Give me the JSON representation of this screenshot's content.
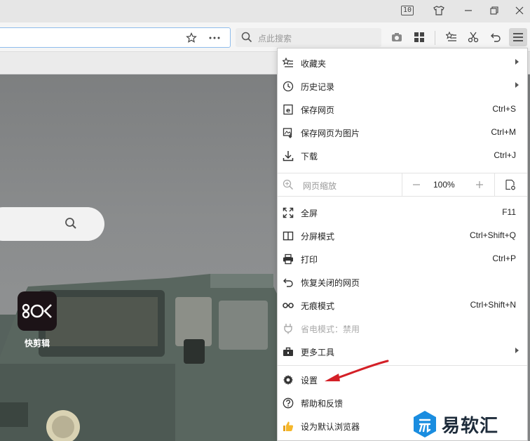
{
  "titlebar": {
    "tab_count": "10"
  },
  "toolbar": {
    "search_placeholder": "点此搜索"
  },
  "home": {
    "tile_label": "快剪辑"
  },
  "menu": {
    "items": [
      {
        "label": "收藏夹",
        "icon": "favorites-list-icon",
        "submenu": true
      },
      {
        "label": "历史记录",
        "icon": "clock-icon",
        "submenu": true
      },
      {
        "label": "保存网页",
        "icon": "save-page-icon",
        "shortcut": "Ctrl+S"
      },
      {
        "label": "保存网页为图片",
        "icon": "save-image-icon",
        "shortcut": "Ctrl+M"
      },
      {
        "label": "下载",
        "icon": "download-icon",
        "shortcut": "Ctrl+J"
      }
    ],
    "zoom": {
      "label": "网页缩放",
      "value": "100%"
    },
    "items2": [
      {
        "label": "全屏",
        "icon": "fullscreen-icon",
        "shortcut": "F11"
      },
      {
        "label": "分屏模式",
        "icon": "split-screen-icon",
        "shortcut": "Ctrl+Shift+Q"
      },
      {
        "label": "打印",
        "icon": "printer-icon",
        "shortcut": "Ctrl+P"
      },
      {
        "label": "恢复关闭的网页",
        "icon": "undo-icon"
      },
      {
        "label": "无痕模式",
        "icon": "incognito-mask-icon",
        "shortcut": "Ctrl+Shift+N"
      },
      {
        "label": "省电模式：禁用",
        "icon": "power-plug-icon",
        "disabled": true
      },
      {
        "label": "更多工具",
        "icon": "toolbox-icon",
        "submenu": true
      }
    ],
    "items3": [
      {
        "label": "设置",
        "icon": "gear-icon"
      },
      {
        "label": "帮助和反馈",
        "icon": "help-icon"
      },
      {
        "label": "设为默认浏览器",
        "icon": "thumbs-up-icon"
      }
    ]
  },
  "watermark": {
    "text": "易软汇"
  },
  "colors": {
    "accent_blue": "#1a8de0",
    "arrow_red": "#d42027",
    "address_border": "#8fbcec"
  }
}
